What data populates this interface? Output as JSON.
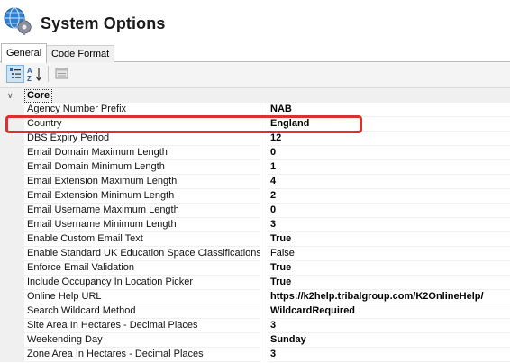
{
  "window": {
    "title": "System Options"
  },
  "tabs": [
    {
      "label": "General",
      "active": true
    },
    {
      "label": "Code Format",
      "active": false
    }
  ],
  "toolbar": {
    "buttons": [
      {
        "name": "categorized-view",
        "pressed": true
      },
      {
        "name": "alphabetical-sort",
        "pressed": false
      },
      {
        "name": "property-pages",
        "pressed": false
      }
    ]
  },
  "grid": {
    "category": {
      "label": "Core",
      "expanded": true
    },
    "rows": [
      {
        "name": "Agency Number Prefix",
        "value": "NAB",
        "bold": true
      },
      {
        "name": "Country",
        "value": "England",
        "bold": true,
        "highlighted": true
      },
      {
        "name": "DBS Expiry Period",
        "value": "12",
        "bold": true
      },
      {
        "name": "Email Domain Maximum Length",
        "value": "0",
        "bold": true
      },
      {
        "name": "Email Domain Minimum Length",
        "value": "1",
        "bold": true
      },
      {
        "name": "Email Extension Maximum Length",
        "value": "4",
        "bold": true
      },
      {
        "name": "Email Extension Minimum Length",
        "value": "2",
        "bold": true
      },
      {
        "name": "Email Username Maximum Length",
        "value": "0",
        "bold": true
      },
      {
        "name": "Email Username Minimum Length",
        "value": "3",
        "bold": true
      },
      {
        "name": "Enable Custom Email Text",
        "value": "True",
        "bold": true
      },
      {
        "name": "Enable Standard UK Education Space Classifications",
        "value": "False",
        "bold": false
      },
      {
        "name": "Enforce Email Validation",
        "value": "True",
        "bold": true
      },
      {
        "name": "Include Occupancy In Location Picker",
        "value": "True",
        "bold": true
      },
      {
        "name": "Online Help URL",
        "value": "https://k2help.tribalgroup.com/K2OnlineHelp/",
        "bold": true
      },
      {
        "name": "Search Wildcard Method",
        "value": "WildcardRequired",
        "bold": true
      },
      {
        "name": "Site Area In Hectares - Decimal Places",
        "value": "3",
        "bold": true
      },
      {
        "name": "Weekending Day",
        "value": "Sunday",
        "bold": true
      },
      {
        "name": "Zone Area In Hectares - Decimal Places",
        "value": "3",
        "bold": true
      }
    ]
  },
  "colors": {
    "highlight": "#d9312e",
    "grid_line": "#f0f0f0",
    "selected_tool": "#cce4f7"
  }
}
